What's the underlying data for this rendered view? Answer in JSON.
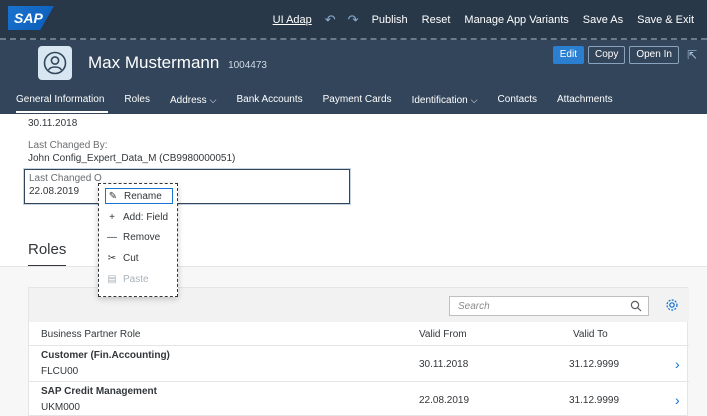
{
  "shell": {
    "logo": "SAP",
    "actions": {
      "ui_adapt": "UI Adap",
      "publish": "Publish",
      "reset": "Reset",
      "manage_app_variants": "Manage App Variants",
      "save_as": "Save As",
      "save_exit": "Save & Exit"
    }
  },
  "header": {
    "name": "Max Mustermann",
    "id": "1004473",
    "buttons": {
      "edit": "Edit",
      "copy": "Copy",
      "open_in": "Open In"
    }
  },
  "tabs": [
    {
      "label": "General Information"
    },
    {
      "label": "Roles"
    },
    {
      "label": "Address",
      "dropdown": true
    },
    {
      "label": "Bank Accounts"
    },
    {
      "label": "Payment Cards"
    },
    {
      "label": "Identification",
      "dropdown": true
    },
    {
      "label": "Contacts"
    },
    {
      "label": "Attachments"
    }
  ],
  "fields": {
    "date_top": "30.11.2018",
    "last_changed_by_label": "Last Changed By:",
    "last_changed_by_value": "John Config_Expert_Data_M (CB9980000051)",
    "last_changed_on_label": "Last Changed O",
    "last_changed_on_value": "22.08.2019"
  },
  "context_menu": {
    "rename": "Rename",
    "add_field": "Add: Field",
    "remove": "Remove",
    "cut": "Cut",
    "paste": "Paste"
  },
  "roles": {
    "title": "Roles",
    "search_placeholder": "Search",
    "columns": {
      "role": "Business Partner Role",
      "valid_from": "Valid From",
      "valid_to": "Valid To"
    },
    "rows": [
      {
        "name": "Customer (Fin.Accounting)",
        "code": "FLCU00",
        "valid_from": "30.11.2018",
        "valid_to": "31.12.9999"
      },
      {
        "name": "SAP Credit Management",
        "code": "UKM000",
        "valid_from": "22.08.2019",
        "valid_to": "31.12.9999"
      }
    ]
  }
}
